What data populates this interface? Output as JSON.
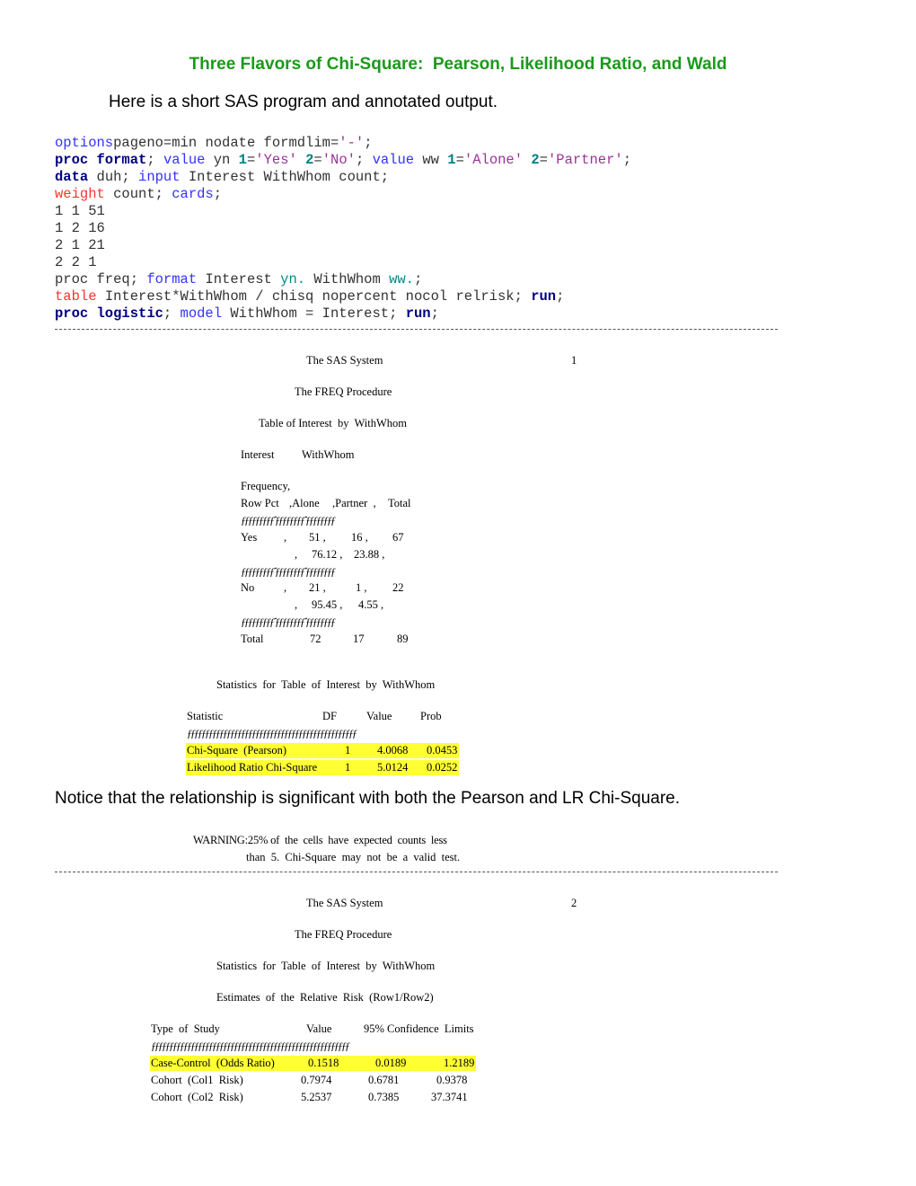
{
  "title": "Three Flavors of Chi-Square:  Pearson, Likelihood Ratio, and Wald",
  "intro": "Here is a short SAS program and annotated output.",
  "code": [
    [
      [
        "kw",
        "options"
      ],
      [
        "",
        "pageno=min nodate formdlim="
      ],
      [
        "st",
        "'-'"
      ],
      [
        "",
        ";"
      ]
    ],
    [
      [
        "pk",
        "proc format"
      ],
      [
        "",
        ";"
      ],
      [
        "kw",
        " value"
      ],
      [
        "",
        " yn "
      ],
      [
        "nm",
        "1"
      ],
      [
        "",
        "="
      ],
      [
        "st",
        "'Yes'"
      ],
      [
        "nm",
        " 2"
      ],
      [
        "",
        "="
      ],
      [
        "st",
        "'No'"
      ],
      [
        "",
        ";"
      ],
      [
        "kw",
        " value"
      ],
      [
        "",
        " ww "
      ],
      [
        "nm",
        "1"
      ],
      [
        "",
        "="
      ],
      [
        "st",
        "'Alone'"
      ],
      [
        "nm",
        " 2"
      ],
      [
        "",
        "="
      ],
      [
        "st",
        "'Partner'"
      ],
      [
        "",
        ";"
      ]
    ],
    [
      [
        "pk",
        "data"
      ],
      [
        "",
        " duh; "
      ],
      [
        "kw",
        "input"
      ],
      [
        "",
        " Interest WithWhom count;"
      ]
    ],
    [
      [
        "rd",
        "weight"
      ],
      [
        "",
        " count; "
      ],
      [
        "kw",
        "cards"
      ],
      [
        "",
        ";"
      ]
    ],
    [
      [
        "",
        "1 1 51"
      ]
    ],
    [
      [
        "",
        "1 2 16"
      ]
    ],
    [
      [
        "",
        "2 1 21"
      ]
    ],
    [
      [
        "",
        "2 2 1"
      ]
    ],
    [
      [
        "",
        "proc freq; "
      ],
      [
        "kw",
        "format"
      ],
      [
        "",
        " Interest "
      ],
      [
        "tl",
        "yn."
      ],
      [
        "",
        " WithWhom "
      ],
      [
        "tl",
        "ww."
      ],
      [
        "",
        ";"
      ]
    ],
    [
      [
        "rd",
        "table"
      ],
      [
        "",
        " Interest*WithWhom / chisq nopercent nocol relrisk; "
      ],
      [
        "pk",
        "run"
      ],
      [
        "",
        ";"
      ]
    ],
    [
      [
        "pk",
        "proc logistic"
      ],
      [
        "",
        "; "
      ],
      [
        "kw",
        "model"
      ],
      [
        "",
        " WithWhom = Interest; "
      ],
      [
        "pk",
        "run"
      ],
      [
        "",
        ";"
      ]
    ]
  ],
  "page1": {
    "system": "The SAS System",
    "page_no": "1",
    "procedure": "The FREQ Procedure",
    "table_title": "Table of Interest  by  WithWhom",
    "row_var": "Interest",
    "col_var": "WithWhom",
    "freq_label": "Frequency,",
    "rowpct_label": "Row Pct",
    "col_headers": [
      ",Alone",
      ",Partner  ,",
      "Total"
    ],
    "sep": "ƒƒƒƒƒƒƒƒƒˆƒƒƒƒƒƒƒƒˆƒƒƒƒƒƒƒƒ",
    "rows": [
      {
        "label": "Yes",
        "freq": [
          "51 ,",
          "16 ,",
          "67"
        ],
        "pct": [
          "76.12 ,",
          "23.88 ,"
        ]
      },
      {
        "label": "No",
        "freq": [
          "21 ,",
          "1 ,",
          "22"
        ],
        "pct": [
          "95.45 ,",
          "4.55 ,"
        ]
      }
    ],
    "total": {
      "label": "Total",
      "values": [
        "72",
        "17",
        "89"
      ]
    },
    "stats_title": "Statistics  for  Table  of  Interest  by  WithWhom",
    "stats_headers": [
      "Statistic",
      "DF",
      "Value",
      "Prob"
    ],
    "stats_sep": "ƒƒƒƒƒƒƒƒƒƒƒƒƒƒƒƒƒƒƒƒƒƒƒƒƒƒƒƒƒƒƒƒƒƒƒƒƒƒƒƒƒƒƒƒƒƒƒ",
    "stats": [
      [
        "Chi-Square  (Pearson)",
        "1",
        "4.0068",
        "0.0453"
      ],
      [
        "Likelihood Ratio Chi-Square",
        "1",
        "5.0124",
        "0.0252"
      ]
    ]
  },
  "notice": "Notice that the relationship is significant with both the Pearson and LR Chi-Square.",
  "warning1": "WARNING:25% of  the  cells  have  expected  counts  less",
  "warning2": "than  5.  Chi-Square  may  not  be  a  valid  test.",
  "page2": {
    "system": "The SAS System",
    "page_no": "2",
    "procedure": "The FREQ Procedure",
    "stats_title": "Statistics  for  Table  of  Interest  by  WithWhom",
    "rr_title": "Estimates  of  the  Relative  Risk  (Row1/Row2)",
    "headers": [
      "Type  of  Study",
      "Value",
      "95% Confidence  Limits"
    ],
    "sep": "ƒƒƒƒƒƒƒƒƒƒƒƒƒƒƒƒƒƒƒƒƒƒƒƒƒƒƒƒƒƒƒƒƒƒƒƒƒƒƒƒƒƒƒƒƒƒƒƒƒƒƒƒƒƒƒ",
    "rows": [
      [
        "Case-Control  (Odds Ratio)",
        "0.1518",
        "0.0189",
        "1.2189"
      ],
      [
        "Cohort  (Col1  Risk)",
        "0.7974",
        "0.6781",
        "0.9378"
      ],
      [
        "Cohort  (Col2  Risk)",
        "5.2537",
        "0.7385",
        "37.3741"
      ]
    ]
  },
  "colors": {
    "title": "#1a9a1a",
    "highlight": "#ffff33"
  }
}
